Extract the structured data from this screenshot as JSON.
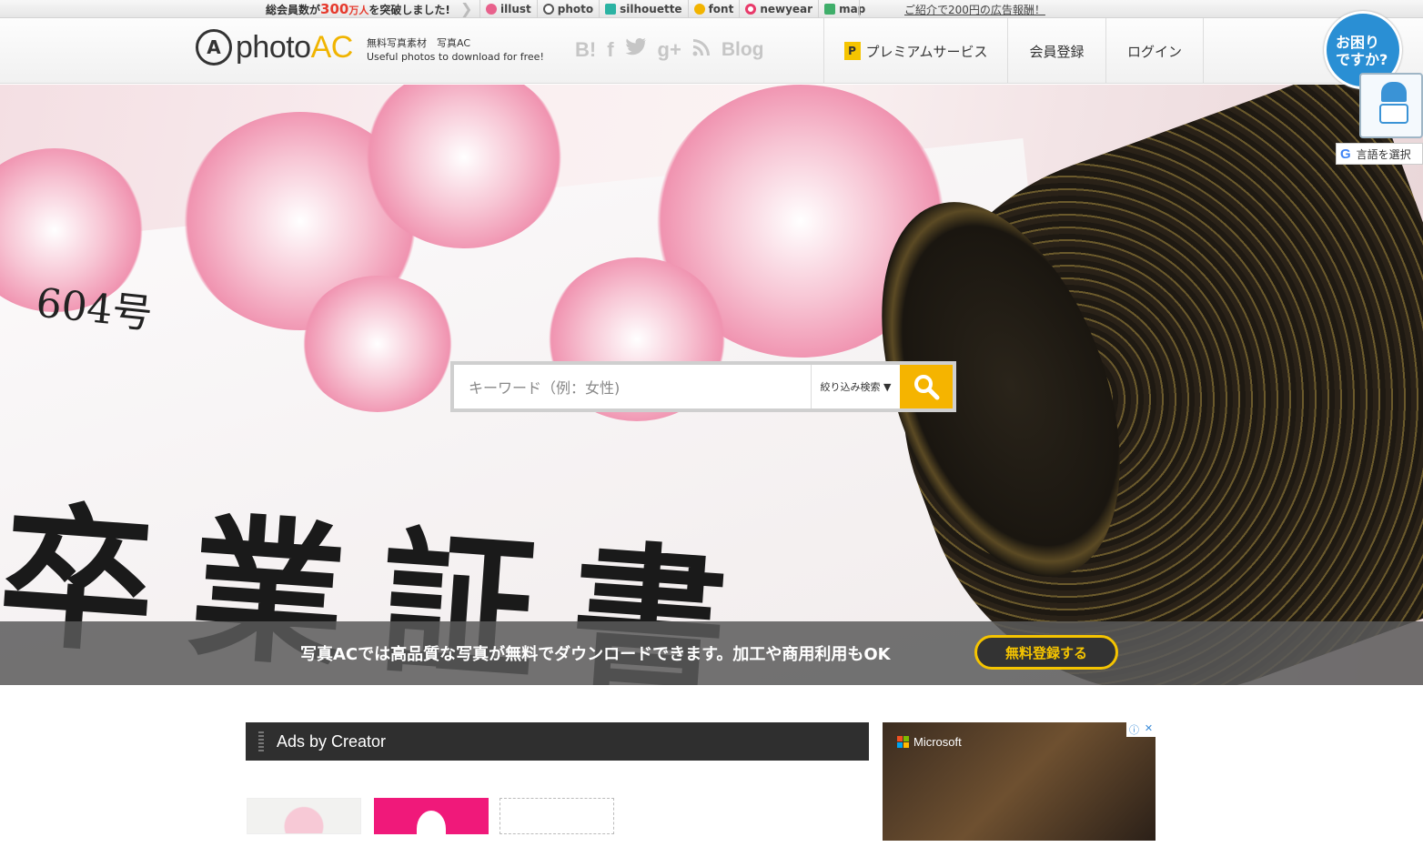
{
  "topbar": {
    "members_prefix": "総会員数が",
    "members_number": "300",
    "members_unit": "万人",
    "members_suffix": "を突破しました!",
    "sites": [
      {
        "label": "illust",
        "icon": "illust-icon",
        "color": "#e8618c"
      },
      {
        "label": "photo",
        "icon": "photo-icon",
        "color": "#555555"
      },
      {
        "label": "silhouette",
        "icon": "silhouette-icon",
        "color": "#2bb3a3"
      },
      {
        "label": "font",
        "icon": "font-icon",
        "color": "#f2b400"
      },
      {
        "label": "newyear",
        "icon": "newyear-icon",
        "color": "#e83a6a"
      },
      {
        "label": "map",
        "icon": "map-icon",
        "color": "#3fae6a"
      }
    ],
    "ad_link": "ご紹介で200円の広告報酬！"
  },
  "header": {
    "logo_photo": "photo",
    "logo_ac": "AC",
    "tagline_line1": "無料写真素材　写真AC",
    "tagline_line2": "Useful photos to download for free!",
    "social": {
      "hatena": "B!",
      "facebook": "f",
      "twitter": "🐦",
      "gplus": "g+",
      "rss": "≋",
      "blog": "Blog"
    },
    "nav": {
      "premium_badge": "P",
      "premium": "プレミアムサービス",
      "register": "会員登録",
      "login": "ログイン"
    }
  },
  "help": {
    "bubble": "お困り\nですか?",
    "lang_label": "言語を選択",
    "lang_g": "G"
  },
  "hero": {
    "search_placeholder": "キーワード（例：女性)",
    "filter_label": "絞り込み検索 ▼",
    "promo_text": "写真ACでは高品質な写真が無料でダウンロードできます。加工や商用利用もOK",
    "promo_button": "無料登録する"
  },
  "main": {
    "ads_heading": "Ads by Creator",
    "ad_brand": "Microsoft"
  },
  "colors": {
    "accent": "#f5b400",
    "help_blue": "#2a8fd4",
    "promo_red": "#e63b2e"
  }
}
